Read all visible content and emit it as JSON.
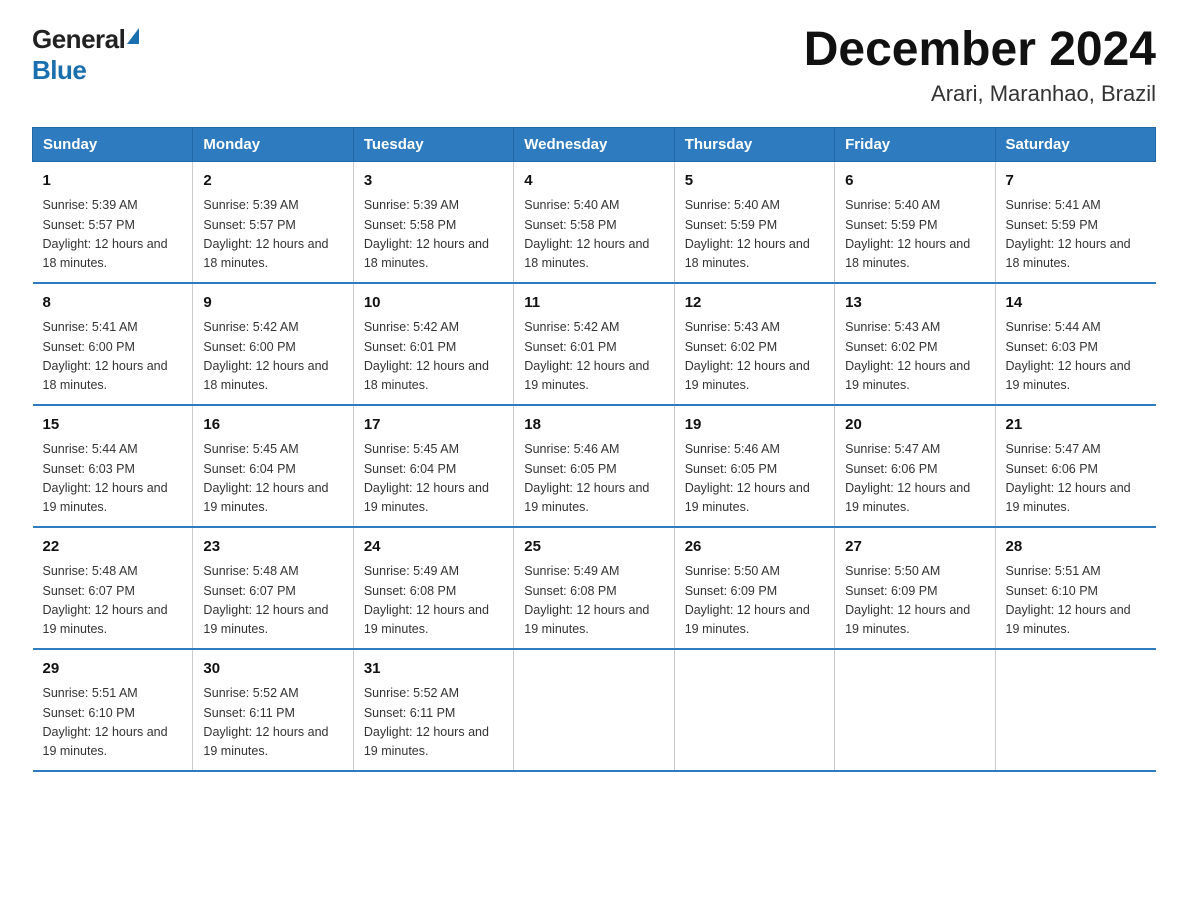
{
  "header": {
    "logo_general": "General",
    "logo_blue": "Blue",
    "month_title": "December 2024",
    "location": "Arari, Maranhao, Brazil"
  },
  "weekdays": [
    "Sunday",
    "Monday",
    "Tuesday",
    "Wednesday",
    "Thursday",
    "Friday",
    "Saturday"
  ],
  "weeks": [
    [
      {
        "day": "1",
        "sunrise": "5:39 AM",
        "sunset": "5:57 PM",
        "daylight": "12 hours and 18 minutes."
      },
      {
        "day": "2",
        "sunrise": "5:39 AM",
        "sunset": "5:57 PM",
        "daylight": "12 hours and 18 minutes."
      },
      {
        "day": "3",
        "sunrise": "5:39 AM",
        "sunset": "5:58 PM",
        "daylight": "12 hours and 18 minutes."
      },
      {
        "day": "4",
        "sunrise": "5:40 AM",
        "sunset": "5:58 PM",
        "daylight": "12 hours and 18 minutes."
      },
      {
        "day": "5",
        "sunrise": "5:40 AM",
        "sunset": "5:59 PM",
        "daylight": "12 hours and 18 minutes."
      },
      {
        "day": "6",
        "sunrise": "5:40 AM",
        "sunset": "5:59 PM",
        "daylight": "12 hours and 18 minutes."
      },
      {
        "day": "7",
        "sunrise": "5:41 AM",
        "sunset": "5:59 PM",
        "daylight": "12 hours and 18 minutes."
      }
    ],
    [
      {
        "day": "8",
        "sunrise": "5:41 AM",
        "sunset": "6:00 PM",
        "daylight": "12 hours and 18 minutes."
      },
      {
        "day": "9",
        "sunrise": "5:42 AM",
        "sunset": "6:00 PM",
        "daylight": "12 hours and 18 minutes."
      },
      {
        "day": "10",
        "sunrise": "5:42 AM",
        "sunset": "6:01 PM",
        "daylight": "12 hours and 18 minutes."
      },
      {
        "day": "11",
        "sunrise": "5:42 AM",
        "sunset": "6:01 PM",
        "daylight": "12 hours and 19 minutes."
      },
      {
        "day": "12",
        "sunrise": "5:43 AM",
        "sunset": "6:02 PM",
        "daylight": "12 hours and 19 minutes."
      },
      {
        "day": "13",
        "sunrise": "5:43 AM",
        "sunset": "6:02 PM",
        "daylight": "12 hours and 19 minutes."
      },
      {
        "day": "14",
        "sunrise": "5:44 AM",
        "sunset": "6:03 PM",
        "daylight": "12 hours and 19 minutes."
      }
    ],
    [
      {
        "day": "15",
        "sunrise": "5:44 AM",
        "sunset": "6:03 PM",
        "daylight": "12 hours and 19 minutes."
      },
      {
        "day": "16",
        "sunrise": "5:45 AM",
        "sunset": "6:04 PM",
        "daylight": "12 hours and 19 minutes."
      },
      {
        "day": "17",
        "sunrise": "5:45 AM",
        "sunset": "6:04 PM",
        "daylight": "12 hours and 19 minutes."
      },
      {
        "day": "18",
        "sunrise": "5:46 AM",
        "sunset": "6:05 PM",
        "daylight": "12 hours and 19 minutes."
      },
      {
        "day": "19",
        "sunrise": "5:46 AM",
        "sunset": "6:05 PM",
        "daylight": "12 hours and 19 minutes."
      },
      {
        "day": "20",
        "sunrise": "5:47 AM",
        "sunset": "6:06 PM",
        "daylight": "12 hours and 19 minutes."
      },
      {
        "day": "21",
        "sunrise": "5:47 AM",
        "sunset": "6:06 PM",
        "daylight": "12 hours and 19 minutes."
      }
    ],
    [
      {
        "day": "22",
        "sunrise": "5:48 AM",
        "sunset": "6:07 PM",
        "daylight": "12 hours and 19 minutes."
      },
      {
        "day": "23",
        "sunrise": "5:48 AM",
        "sunset": "6:07 PM",
        "daylight": "12 hours and 19 minutes."
      },
      {
        "day": "24",
        "sunrise": "5:49 AM",
        "sunset": "6:08 PM",
        "daylight": "12 hours and 19 minutes."
      },
      {
        "day": "25",
        "sunrise": "5:49 AM",
        "sunset": "6:08 PM",
        "daylight": "12 hours and 19 minutes."
      },
      {
        "day": "26",
        "sunrise": "5:50 AM",
        "sunset": "6:09 PM",
        "daylight": "12 hours and 19 minutes."
      },
      {
        "day": "27",
        "sunrise": "5:50 AM",
        "sunset": "6:09 PM",
        "daylight": "12 hours and 19 minutes."
      },
      {
        "day": "28",
        "sunrise": "5:51 AM",
        "sunset": "6:10 PM",
        "daylight": "12 hours and 19 minutes."
      }
    ],
    [
      {
        "day": "29",
        "sunrise": "5:51 AM",
        "sunset": "6:10 PM",
        "daylight": "12 hours and 19 minutes."
      },
      {
        "day": "30",
        "sunrise": "5:52 AM",
        "sunset": "6:11 PM",
        "daylight": "12 hours and 19 minutes."
      },
      {
        "day": "31",
        "sunrise": "5:52 AM",
        "sunset": "6:11 PM",
        "daylight": "12 hours and 19 minutes."
      },
      {
        "day": "",
        "sunrise": "",
        "sunset": "",
        "daylight": ""
      },
      {
        "day": "",
        "sunrise": "",
        "sunset": "",
        "daylight": ""
      },
      {
        "day": "",
        "sunrise": "",
        "sunset": "",
        "daylight": ""
      },
      {
        "day": "",
        "sunrise": "",
        "sunset": "",
        "daylight": ""
      }
    ]
  ]
}
